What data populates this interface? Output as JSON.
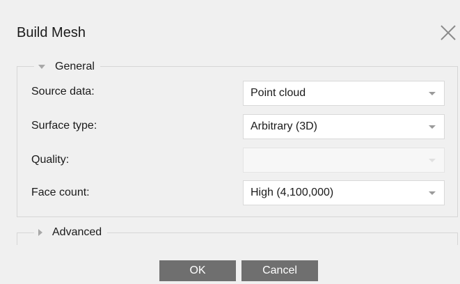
{
  "dialog": {
    "title": "Build Mesh",
    "close_icon": "close-icon"
  },
  "general": {
    "label": "General",
    "expanded": true,
    "rows": [
      {
        "label": "Source data:",
        "value": "Point cloud",
        "enabled": true
      },
      {
        "label": "Surface type:",
        "value": "Arbitrary (3D)",
        "enabled": true
      },
      {
        "label": "Quality:",
        "value": "",
        "enabled": false
      },
      {
        "label": "Face count:",
        "value": "High (4,100,000)",
        "enabled": true
      }
    ]
  },
  "advanced": {
    "label": "Advanced",
    "expanded": false
  },
  "buttons": {
    "ok_label": "OK",
    "cancel_label": "Cancel"
  },
  "colors": {
    "background": "#f0f0f0",
    "button": "#6f6f6f",
    "button_text": "#ffffff"
  }
}
